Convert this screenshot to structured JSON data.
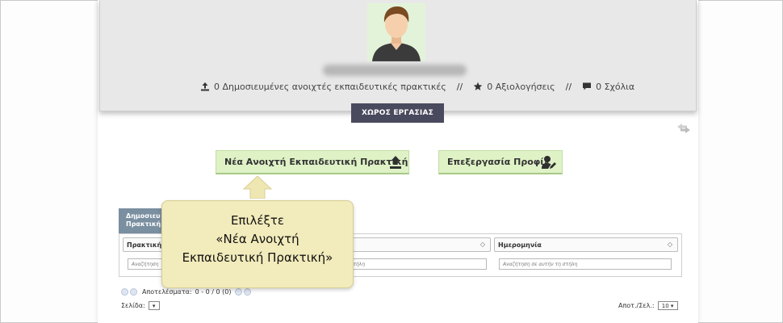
{
  "profile": {
    "stats": [
      {
        "icon": "upload-icon",
        "text": "0 Δημοσιευμένες ανοιχτές εκπαιδευτικές πρακτικές"
      },
      {
        "icon": "star-icon",
        "text": "0 Αξιολογήσεις"
      },
      {
        "icon": "comment-icon",
        "text": "0 Σχόλια"
      }
    ],
    "separator": "//"
  },
  "workspace_tab": "ΧΩΡΟΣ ΕΡΓΑΣΙΑΣ",
  "buttons": {
    "new_practice": "Νέα Ανοιχτή Εκπαιδευτική Πρακτική",
    "edit_profile": "Επεξεργασία Προφίλ"
  },
  "grid": {
    "tab_label_line1": "Δημοσιευ",
    "tab_label_line2": "Πρακτική",
    "columns": [
      {
        "header": "Πρακτική",
        "filter_placeholder": "Αναζήτηση"
      },
      {
        "header": "",
        "filter_placeholder": "αυτήν τη στήλη"
      },
      {
        "header": "Ημερομηνία",
        "filter_placeholder": "Αναζήτηση σε αυτήν τη στήλη"
      }
    ],
    "results_label": "Αποτελέσματα:",
    "results_value": "0 - 0 / 0 (0)",
    "page_label": "Σελίδα:",
    "per_page_label": "Αποτ./Σελ.:",
    "per_page_value": "10 ▾",
    "page_value": "▾"
  },
  "tooltip": {
    "line1": "Επιλέξτε",
    "line2": "«Νέα Ανοιχτή",
    "line3": "Εκπαιδευτική Πρακτική»"
  },
  "colors": {
    "header_bg": "#e8e8e8",
    "tab_bg": "#4a4a5e",
    "button_bg": "#dff2c6",
    "tooltip_bg": "#f2ebbb",
    "arrow": "#efe7b2"
  }
}
